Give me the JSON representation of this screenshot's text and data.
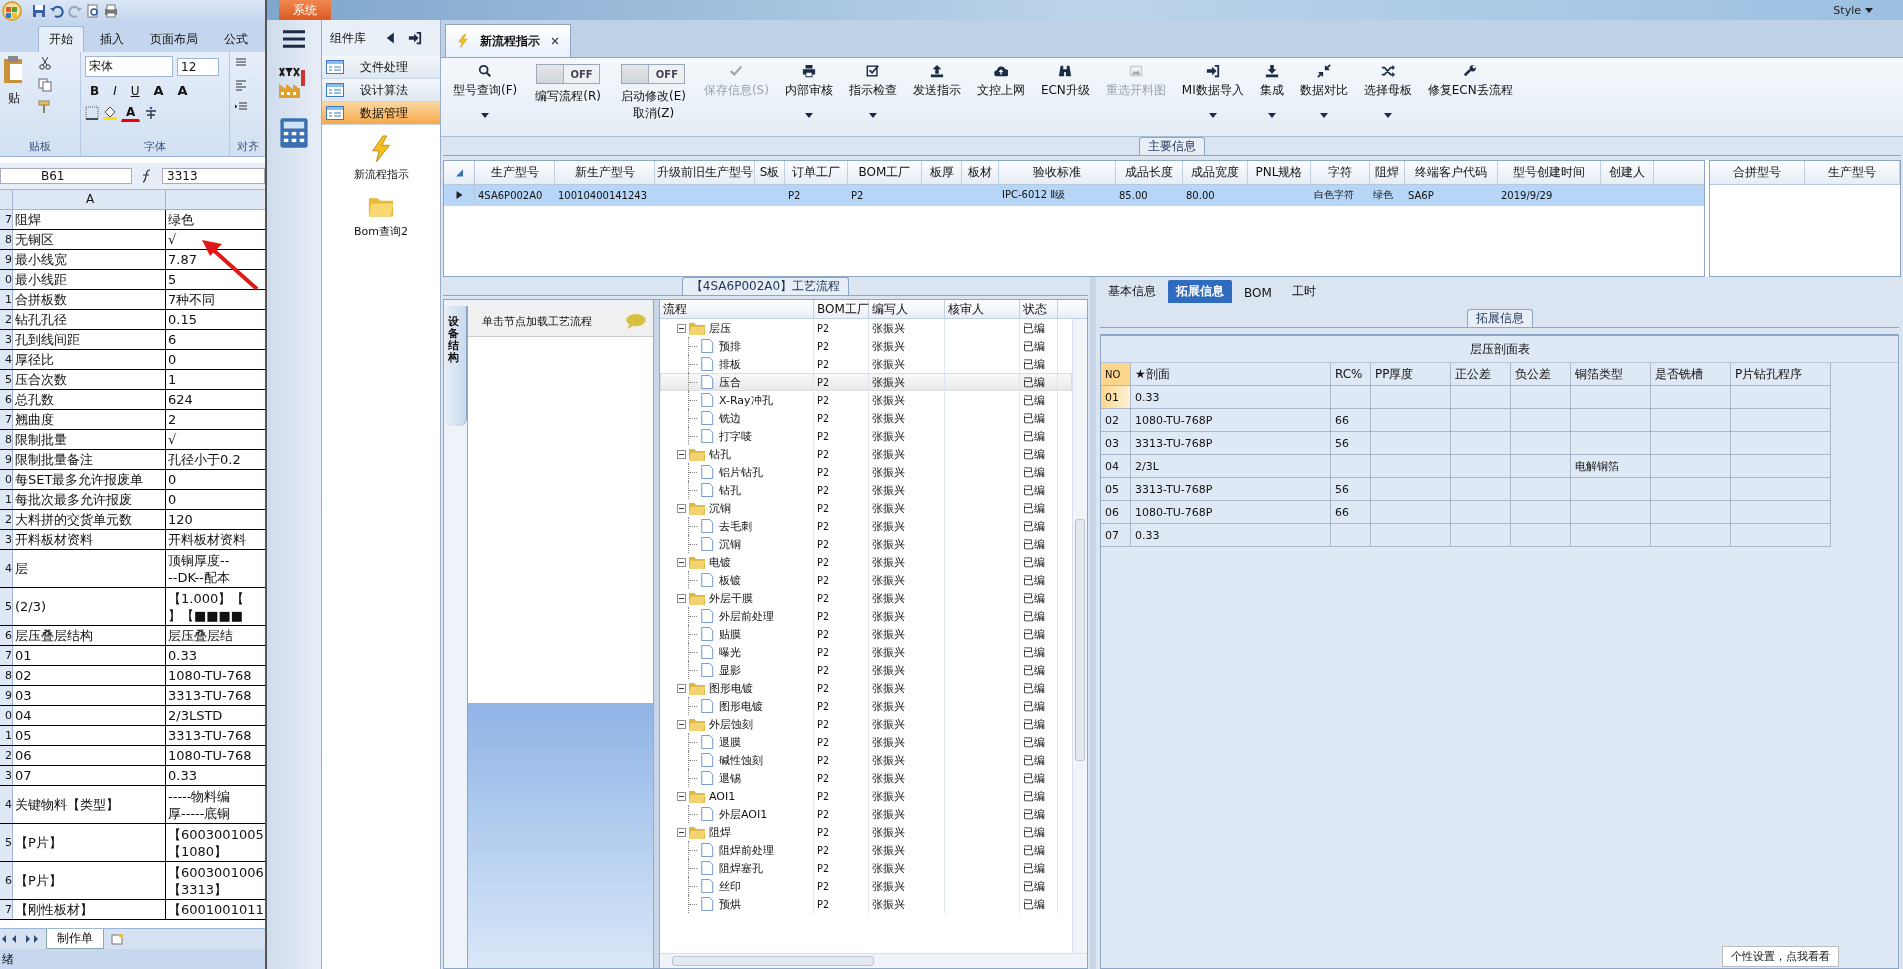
{
  "excel": {
    "ribbon_tabs": [
      {
        "label": "开始",
        "selected": true
      },
      {
        "label": "插入",
        "selected": false
      },
      {
        "label": "页面布局",
        "selected": false
      },
      {
        "label": "公式",
        "selected": false
      }
    ],
    "paste_label": "贴",
    "font_name": "宋体",
    "font_size": "12",
    "format_buttons": [
      "B",
      "I",
      "U"
    ],
    "size_buttons": [
      "A",
      "A"
    ],
    "font_color_button": "A",
    "group_labels": [
      "贴板",
      "字体",
      "对齐"
    ],
    "name_box": "B61",
    "formula": "3313",
    "column_header": "A",
    "rows": [
      {
        "row": "7",
        "a": "阻焊",
        "b": [
          "绿色"
        ]
      },
      {
        "row": "8",
        "a": "无铜区",
        "b": [
          "√"
        ]
      },
      {
        "row": "9",
        "a": "最小线宽",
        "b": [
          "7.87"
        ]
      },
      {
        "row": "0",
        "a": "最小线距",
        "b": [
          "5"
        ]
      },
      {
        "row": "1",
        "a": "合拼板数",
        "b": [
          "7种不同"
        ]
      },
      {
        "row": "2",
        "a": "钻孔孔径",
        "b": [
          "0.15"
        ]
      },
      {
        "row": "3",
        "a": "孔到线间距",
        "b": [
          "6"
        ]
      },
      {
        "row": "4",
        "a": "厚径比",
        "b": [
          "0"
        ]
      },
      {
        "row": "5",
        "a": "压合次数",
        "b": [
          "1"
        ]
      },
      {
        "row": "6",
        "a": "总孔数",
        "b": [
          "624"
        ]
      },
      {
        "row": "7",
        "a": "翘曲度",
        "b": [
          "2"
        ]
      },
      {
        "row": "8",
        "a": "限制批量",
        "b": [
          "√"
        ]
      },
      {
        "row": "9",
        "a": "限制批量备注",
        "b": [
          "孔径小于0.2"
        ]
      },
      {
        "row": "0",
        "a": "每SET最多允许报废单",
        "b": [
          "0"
        ]
      },
      {
        "row": "1",
        "a": "每批次最多允许报废",
        "b": [
          "0"
        ]
      },
      {
        "row": "2",
        "a": "大料拼的交货单元数",
        "b": [
          "120"
        ]
      },
      {
        "row": "3",
        "a": "开料板材资料",
        "b": [
          "开料板材资料"
        ]
      },
      {
        "row": "4",
        "a": "层",
        "b": [
          "顶铜厚度--",
          "--DK--配本"
        ]
      },
      {
        "row": "5",
        "a": "(2/3)",
        "b": [
          "【1.000】【",
          "】【■■■■"
        ]
      },
      {
        "row": "6",
        "a": "层压叠层结构",
        "b": [
          "层压叠层结"
        ]
      },
      {
        "row": "7",
        "a": "01",
        "b": [
          "0.33"
        ]
      },
      {
        "row": "8",
        "a": "02",
        "b": [
          "1080-TU-768"
        ]
      },
      {
        "row": "9",
        "a": "03",
        "b": [
          "3313-TU-768"
        ]
      },
      {
        "row": "0",
        "a": "04",
        "b": [
          "2/3LSTD"
        ]
      },
      {
        "row": "1",
        "a": "05",
        "b": [
          "3313-TU-768"
        ]
      },
      {
        "row": "2",
        "a": "06",
        "b": [
          "1080-TU-768"
        ]
      },
      {
        "row": "3",
        "a": "07",
        "b": [
          "0.33"
        ]
      },
      {
        "row": "4",
        "a": "关键物料【类型】",
        "b": [
          "-----物料编",
          "厚-----底铜"
        ]
      },
      {
        "row": "5",
        "a": "【P片】",
        "b": [
          "【6003001005",
          "【1080】"
        ]
      },
      {
        "row": "6",
        "a": "【P片】",
        "b": [
          "【6003001006",
          "【3313】"
        ]
      },
      {
        "row": "7",
        "a": "【刚性板材】",
        "b": [
          "【6001001011"
        ]
      }
    ],
    "sheet_tab": "制作单",
    "status": "绪"
  },
  "app": {
    "system_tab": "系统",
    "style_menu": "Style",
    "library": {
      "title": "组件库",
      "items": [
        {
          "label": "文件处理",
          "selected": false
        },
        {
          "label": "设计算法",
          "selected": false
        },
        {
          "label": "数据管理",
          "selected": true
        }
      ],
      "shortcuts": [
        "新流程指示",
        "Bom查询2"
      ]
    },
    "doc_tab": "新流程指示",
    "toolbar": [
      {
        "kind": "button",
        "label": "型号查询(F)",
        "dropdown": true,
        "disabled": false
      },
      {
        "kind": "toggle",
        "label": "编写流程(R)",
        "switch_text": "OFF",
        "on": false
      },
      {
        "kind": "toggle",
        "label": "启动修改(E)",
        "label_2": "取消(Z)",
        "switch_text": "OFF",
        "on": false
      },
      {
        "kind": "button",
        "label": "保存信息(S)",
        "dropdown": false,
        "disabled": true
      },
      {
        "kind": "button",
        "label": "内部审核",
        "dropdown": true,
        "disabled": false
      },
      {
        "kind": "button",
        "label": "指示检查",
        "dropdown": true,
        "disabled": false
      },
      {
        "kind": "button",
        "label": "发送指示",
        "dropdown": false,
        "disabled": false
      },
      {
        "kind": "button",
        "label": "文控上网",
        "dropdown": false,
        "disabled": false
      },
      {
        "kind": "button",
        "label": "ECN升级",
        "dropdown": false,
        "disabled": false
      },
      {
        "kind": "button",
        "label": "重选开料图",
        "dropdown": false,
        "disabled": true
      },
      {
        "kind": "button",
        "label": "MI数据导入",
        "dropdown": true,
        "disabled": false
      },
      {
        "kind": "button",
        "label": "集成",
        "dropdown": true,
        "disabled": false
      },
      {
        "kind": "button",
        "label": "数据对比",
        "dropdown": true,
        "disabled": false
      },
      {
        "kind": "button",
        "label": "选择母板",
        "dropdown": true,
        "disabled": false
      },
      {
        "kind": "button",
        "label": "修复ECN丢流程",
        "dropdown": false,
        "disabled": false
      }
    ],
    "main_info": {
      "legend": "主要信息",
      "columns": [
        "生产型号",
        "新生产型号",
        "升级前旧生产型号",
        "S板",
        "订单工厂",
        "BOM工厂",
        "板厚",
        "板材",
        "验收标准",
        "成品长度",
        "成品宽度",
        "PNL规格",
        "字符",
        "阻焊",
        "终端客户代码",
        "型号创建时间",
        "创建人"
      ],
      "rows": [
        {
          "selected": true,
          "cells": [
            "4SA6P002A0",
            "10010400141243",
            null,
            null,
            "P2",
            "P2",
            null,
            null,
            "IPC-6012 Ⅱ级",
            "85.00",
            "80.00",
            null,
            "白色字符",
            "绿色",
            "SA6P",
            "2019/9/29",
            null
          ]
        }
      ]
    },
    "merge_table": {
      "columns": [
        "合拼型号",
        "生产型号"
      ]
    },
    "process": {
      "legend": "【4SA6P002A0】工艺流程",
      "side_tab": "设备结构",
      "hint": "单击节点加载工艺流程",
      "columns": [
        "流程",
        "BOM工厂",
        "编写人",
        "核审人",
        "状态"
      ],
      "tree": [
        {
          "name": "层压",
          "bom": "P2",
          "writer": "张振兴",
          "status": "已编",
          "expanded": true,
          "selected": false,
          "children": [
            {
              "name": "预排",
              "bom": "P2",
              "writer": "张振兴",
              "status": "已编",
              "selected": false
            },
            {
              "name": "排板",
              "bom": "P2",
              "writer": "张振兴",
              "status": "已编",
              "selected": false
            },
            {
              "name": "压合",
              "bom": "P2",
              "writer": "张振兴",
              "status": "已编",
              "selected": true
            },
            {
              "name": "X-Ray冲孔",
              "bom": "P2",
              "writer": "张振兴",
              "status": "已编",
              "selected": false
            },
            {
              "name": "铣边",
              "bom": "P2",
              "writer": "张振兴",
              "status": "已编",
              "selected": false
            },
            {
              "name": "打字唛",
              "bom": "P2",
              "writer": "张振兴",
              "status": "已编",
              "selected": false
            }
          ]
        },
        {
          "name": "钻孔",
          "bom": "P2",
          "writer": "张振兴",
          "status": "已编",
          "expanded": true,
          "selected": false,
          "children": [
            {
              "name": "铝片钻孔",
              "bom": "P2",
              "writer": "张振兴",
              "status": "已编",
              "selected": false
            },
            {
              "name": "钻孔",
              "bom": "P2",
              "writer": "张振兴",
              "status": "已编",
              "selected": false
            }
          ]
        },
        {
          "name": "沉铜",
          "bom": "P2",
          "writer": "张振兴",
          "status": "已编",
          "expanded": true,
          "selected": false,
          "children": [
            {
              "name": "去毛刺",
              "bom": "P2",
              "writer": "张振兴",
              "status": "已编",
              "selected": false
            },
            {
              "name": "沉铜",
              "bom": "P2",
              "writer": "张振兴",
              "status": "已编",
              "selected": false
            }
          ]
        },
        {
          "name": "电镀",
          "bom": "P2",
          "writer": "张振兴",
          "status": "已编",
          "expanded": true,
          "selected": false,
          "children": [
            {
              "name": "板镀",
              "bom": "P2",
              "writer": "张振兴",
              "status": "已编",
              "selected": false
            }
          ]
        },
        {
          "name": "外层干膜",
          "bom": "P2",
          "writer": "张振兴",
          "status": "已编",
          "expanded": true,
          "selected": false,
          "children": [
            {
              "name": "外层前处理",
              "bom": "P2",
              "writer": "张振兴",
              "status": "已编",
              "selected": false
            },
            {
              "name": "贴膜",
              "bom": "P2",
              "writer": "张振兴",
              "status": "已编",
              "selected": false
            },
            {
              "name": "曝光",
              "bom": "P2",
              "writer": "张振兴",
              "status": "已编",
              "selected": false
            },
            {
              "name": "显影",
              "bom": "P2",
              "writer": "张振兴",
              "status": "已编",
              "selected": false
            }
          ]
        },
        {
          "name": "图形电镀",
          "bom": "P2",
          "writer": "张振兴",
          "status": "已编",
          "expanded": true,
          "selected": false,
          "children": [
            {
              "name": "图形电镀",
              "bom": "P2",
              "writer": "张振兴",
              "status": "已编",
              "selected": false
            }
          ]
        },
        {
          "name": "外层蚀刻",
          "bom": "P2",
          "writer": "张振兴",
          "status": "已编",
          "expanded": true,
          "selected": false,
          "children": [
            {
              "name": "退膜",
              "bom": "P2",
              "writer": "张振兴",
              "status": "已编",
              "selected": false
            },
            {
              "name": "碱性蚀刻",
              "bom": "P2",
              "writer": "张振兴",
              "status": "已编",
              "selected": false
            },
            {
              "name": "退锡",
              "bom": "P2",
              "writer": "张振兴",
              "status": "已编",
              "selected": false
            }
          ]
        },
        {
          "name": "AOI1",
          "bom": "P2",
          "writer": "张振兴",
          "status": "已编",
          "expanded": true,
          "selected": false,
          "children": [
            {
              "name": "外层AOI1",
              "bom": "P2",
              "writer": "张振兴",
              "status": "已编",
              "selected": false
            }
          ]
        },
        {
          "name": "阻焊",
          "bom": "P2",
          "writer": "张振兴",
          "status": "已编",
          "expanded": true,
          "selected": false,
          "children": [
            {
              "name": "阻焊前处理",
              "bom": "P2",
              "writer": "张振兴",
              "status": "已编",
              "selected": false
            },
            {
              "name": "阻焊塞孔",
              "bom": "P2",
              "writer": "张振兴",
              "status": "已编",
              "selected": false
            },
            {
              "name": "丝印",
              "bom": "P2",
              "writer": "张振兴",
              "status": "已编",
              "selected": false
            },
            {
              "name": "预烘",
              "bom": "P2",
              "writer": "张振兴",
              "status": "已编",
              "selected": false
            }
          ]
        }
      ]
    },
    "detail": {
      "tabs": [
        {
          "label": "基本信息",
          "selected": false
        },
        {
          "label": "拓展信息",
          "selected": true
        },
        {
          "label": "BOM",
          "selected": false
        },
        {
          "label": "工时",
          "selected": false
        }
      ],
      "legend": "拓展信息",
      "table": {
        "title": "层压剖面表",
        "columns": [
          "NO",
          "★剖面",
          "RC%",
          "PP厚度",
          "正公差",
          "负公差",
          "铜箔类型",
          "是否铣槽",
          "P片钻孔程序"
        ],
        "rows": [
          {
            "selected": true,
            "cells": [
              "01",
              "0.33",
              null,
              null,
              null,
              null,
              null,
              null,
              null
            ]
          },
          {
            "selected": false,
            "cells": [
              "02",
              "1080-TU-768P",
              "66",
              null,
              null,
              null,
              null,
              null,
              null
            ]
          },
          {
            "selected": false,
            "cells": [
              "03",
              "3313-TU-768P",
              "56",
              null,
              null,
              null,
              null,
              null,
              null
            ]
          },
          {
            "selected": false,
            "cells": [
              "04",
              "2/3L",
              null,
              null,
              null,
              null,
              "电解铜箔",
              null,
              null
            ]
          },
          {
            "selected": false,
            "cells": [
              "05",
              "3313-TU-768P",
              "56",
              null,
              null,
              null,
              null,
              null,
              null
            ]
          },
          {
            "selected": false,
            "cells": [
              "06",
              "1080-TU-768P",
              "66",
              null,
              null,
              null,
              null,
              null,
              null
            ]
          },
          {
            "selected": false,
            "cells": [
              "07",
              "0.33",
              null,
              null,
              null,
              null,
              null,
              null,
              null
            ]
          }
        ]
      }
    },
    "tip": "个性设置，点我看看"
  }
}
